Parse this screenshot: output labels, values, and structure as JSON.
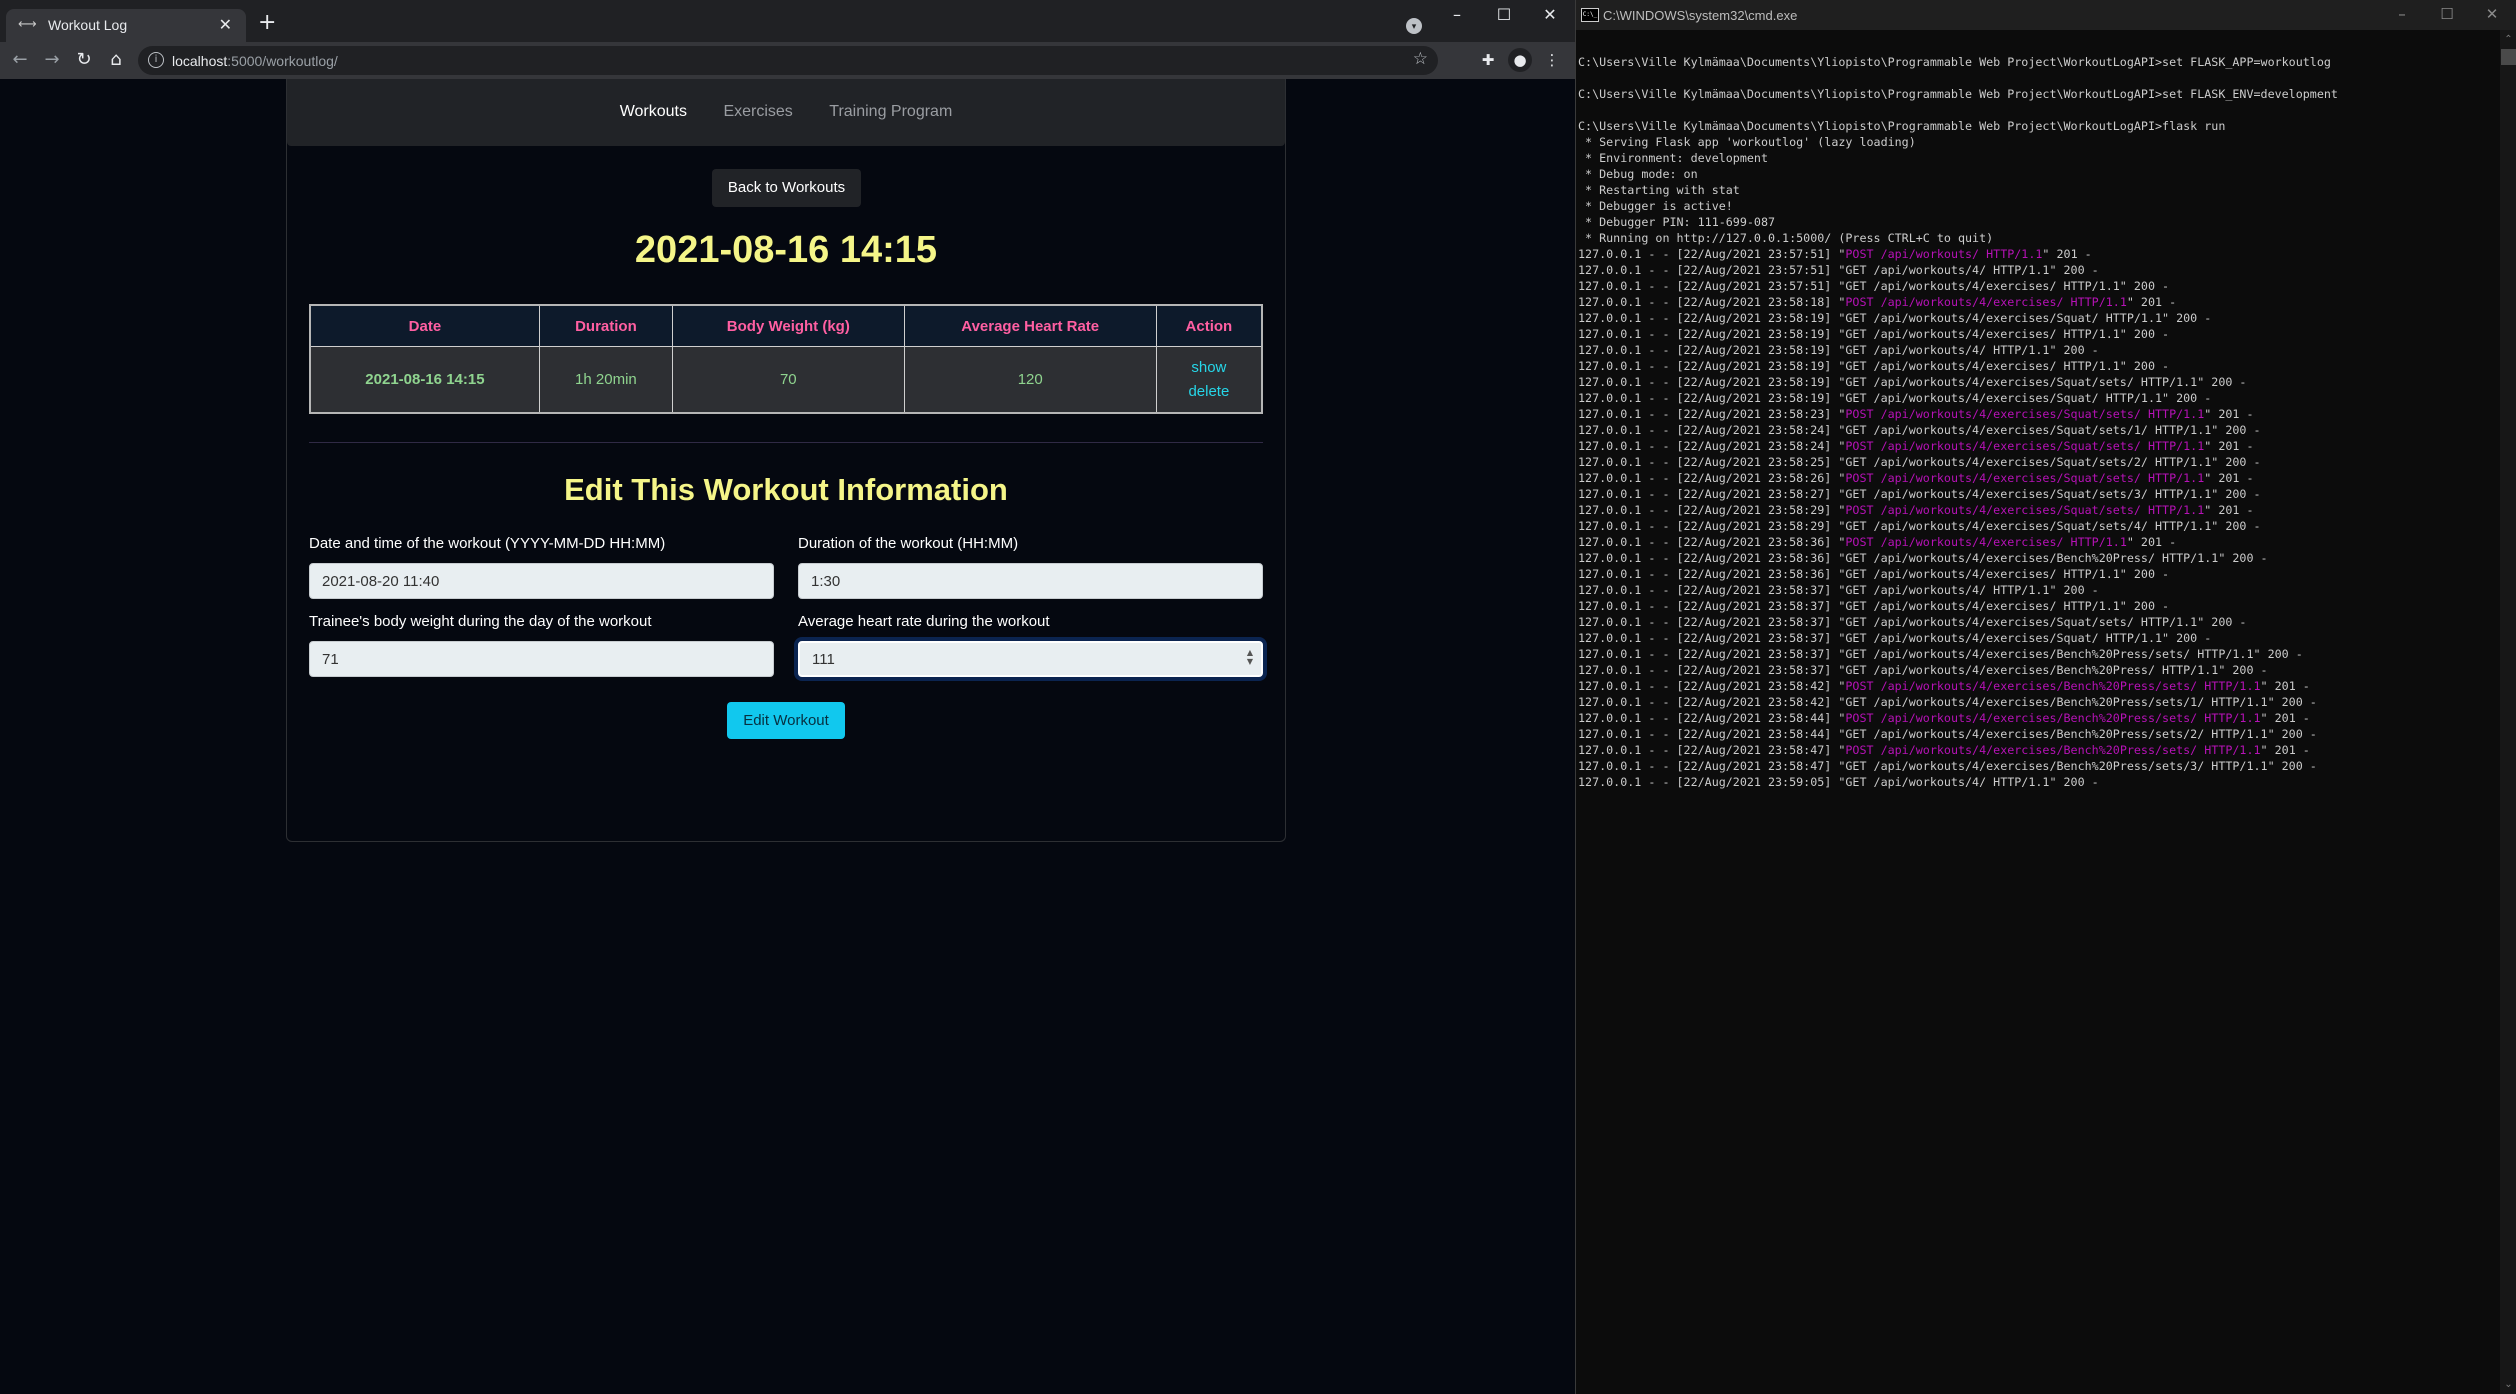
{
  "browser": {
    "tab_title": "Workout Log",
    "url_host": "localhost",
    "url_rest": ":5000/workoutlog/",
    "icons": {
      "favicon": "arrows-horizontal-icon",
      "close": "close-icon",
      "new_tab": "plus-icon",
      "back": "arrow-left-icon",
      "forward": "arrow-right-icon",
      "reload": "reload-icon",
      "home": "home-icon",
      "site_info": "info-icon",
      "bookmark": "star-icon",
      "extensions": "puzzle-icon",
      "profile": "person-icon",
      "menu": "kebab-icon"
    }
  },
  "nav": {
    "items": [
      {
        "label": "Workouts",
        "active": true
      },
      {
        "label": "Exercises",
        "active": false
      },
      {
        "label": "Training Program",
        "active": false
      }
    ]
  },
  "page": {
    "back_button": "Back to Workouts",
    "workout_title": "2021-08-16 14:15",
    "table": {
      "headers": [
        "Date",
        "Duration",
        "Body Weight (kg)",
        "Average Heart Rate",
        "Action"
      ],
      "rows": [
        {
          "date": "2021-08-16 14:15",
          "duration": "1h 20min",
          "body_weight": "70",
          "avg_heart_rate": "120",
          "actions": [
            "show",
            "delete"
          ]
        }
      ]
    },
    "edit_title": "Edit This Workout Information",
    "form": {
      "date_label": "Date and time of the workout (YYYY-MM-DD HH:MM)",
      "date_value": "2021-08-20 11:40",
      "duration_label": "Duration of the workout (HH:MM)",
      "duration_value": "1:30",
      "weight_label": "Trainee's body weight during the day of the workout",
      "weight_value": "71",
      "heart_label": "Average heart rate during the workout",
      "heart_value": "111",
      "submit": "Edit Workout"
    },
    "colors": {
      "title": "#f5f588",
      "table_header": "#ff5fa2",
      "table_cell": "#8fd48f",
      "link": "#26d6e8",
      "submit": "#11c8ee"
    }
  },
  "cmd": {
    "title": "C:\\WINDOWS\\system32\\cmd.exe",
    "lines": [
      {
        "text": ""
      },
      {
        "text": "C:\\Users\\Ville Kylmämaa\\Documents\\Yliopisto\\Programmable Web Project\\WorkoutLogAPI>set FLASK_APP=workoutlog"
      },
      {
        "text": ""
      },
      {
        "text": "C:\\Users\\Ville Kylmämaa\\Documents\\Yliopisto\\Programmable Web Project\\WorkoutLogAPI>set FLASK_ENV=development"
      },
      {
        "text": ""
      },
      {
        "text": "C:\\Users\\Ville Kylmämaa\\Documents\\Yliopisto\\Programmable Web Project\\WorkoutLogAPI>flask run"
      },
      {
        "text": " * Serving Flask app 'workoutlog' (lazy loading)"
      },
      {
        "text": " * Environment: development"
      },
      {
        "text": " * Debug mode: on"
      },
      {
        "text": " * Restarting with stat"
      },
      {
        "text": " * Debugger is active!"
      },
      {
        "text": " * Debugger PIN: 111-699-087"
      },
      {
        "text": " * Running on http://127.0.0.1:5000/ (Press CTRL+C to quit)"
      },
      {
        "pre": "127.0.0.1 - - [22/Aug/2021 23:57:51] \"",
        "req": "POST /api/workouts/ HTTP/1.1",
        "post": "\" 201 -"
      },
      {
        "pre": "127.0.0.1 - - [22/Aug/2021 23:57:51] \"GET /api/workouts/4/ HTTP/1.1\" 200 -"
      },
      {
        "pre": "127.0.0.1 - - [22/Aug/2021 23:57:51] \"GET /api/workouts/4/exercises/ HTTP/1.1\" 200 -"
      },
      {
        "pre": "127.0.0.1 - - [22/Aug/2021 23:58:18] \"",
        "req": "POST /api/workouts/4/exercises/ HTTP/1.1",
        "post": "\" 201 -"
      },
      {
        "pre": "127.0.0.1 - - [22/Aug/2021 23:58:19] \"GET /api/workouts/4/exercises/Squat/ HTTP/1.1\" 200 -"
      },
      {
        "pre": "127.0.0.1 - - [22/Aug/2021 23:58:19] \"GET /api/workouts/4/exercises/ HTTP/1.1\" 200 -"
      },
      {
        "pre": "127.0.0.1 - - [22/Aug/2021 23:58:19] \"GET /api/workouts/4/ HTTP/1.1\" 200 -"
      },
      {
        "pre": "127.0.0.1 - - [22/Aug/2021 23:58:19] \"GET /api/workouts/4/exercises/ HTTP/1.1\" 200 -"
      },
      {
        "pre": "127.0.0.1 - - [22/Aug/2021 23:58:19] \"GET /api/workouts/4/exercises/Squat/sets/ HTTP/1.1\" 200 -"
      },
      {
        "pre": "127.0.0.1 - - [22/Aug/2021 23:58:19] \"GET /api/workouts/4/exercises/Squat/ HTTP/1.1\" 200 -"
      },
      {
        "pre": "127.0.0.1 - - [22/Aug/2021 23:58:23] \"",
        "req": "POST /api/workouts/4/exercises/Squat/sets/ HTTP/1.1",
        "post": "\" 201 -"
      },
      {
        "pre": "127.0.0.1 - - [22/Aug/2021 23:58:24] \"GET /api/workouts/4/exercises/Squat/sets/1/ HTTP/1.1\" 200 -"
      },
      {
        "pre": "127.0.0.1 - - [22/Aug/2021 23:58:24] \"",
        "req": "POST /api/workouts/4/exercises/Squat/sets/ HTTP/1.1",
        "post": "\" 201 -"
      },
      {
        "pre": "127.0.0.1 - - [22/Aug/2021 23:58:25] \"GET /api/workouts/4/exercises/Squat/sets/2/ HTTP/1.1\" 200 -"
      },
      {
        "pre": "127.0.0.1 - - [22/Aug/2021 23:58:26] \"",
        "req": "POST /api/workouts/4/exercises/Squat/sets/ HTTP/1.1",
        "post": "\" 201 -"
      },
      {
        "pre": "127.0.0.1 - - [22/Aug/2021 23:58:27] \"GET /api/workouts/4/exercises/Squat/sets/3/ HTTP/1.1\" 200 -"
      },
      {
        "pre": "127.0.0.1 - - [22/Aug/2021 23:58:29] \"",
        "req": "POST /api/workouts/4/exercises/Squat/sets/ HTTP/1.1",
        "post": "\" 201 -"
      },
      {
        "pre": "127.0.0.1 - - [22/Aug/2021 23:58:29] \"GET /api/workouts/4/exercises/Squat/sets/4/ HTTP/1.1\" 200 -"
      },
      {
        "pre": "127.0.0.1 - - [22/Aug/2021 23:58:36] \"",
        "req": "POST /api/workouts/4/exercises/ HTTP/1.1",
        "post": "\" 201 -"
      },
      {
        "pre": "127.0.0.1 - - [22/Aug/2021 23:58:36] \"GET /api/workouts/4/exercises/Bench%20Press/ HTTP/1.1\" 200 -"
      },
      {
        "pre": "127.0.0.1 - - [22/Aug/2021 23:58:36] \"GET /api/workouts/4/exercises/ HTTP/1.1\" 200 -"
      },
      {
        "pre": "127.0.0.1 - - [22/Aug/2021 23:58:37] \"GET /api/workouts/4/ HTTP/1.1\" 200 -"
      },
      {
        "pre": "127.0.0.1 - - [22/Aug/2021 23:58:37] \"GET /api/workouts/4/exercises/ HTTP/1.1\" 200 -"
      },
      {
        "pre": "127.0.0.1 - - [22/Aug/2021 23:58:37] \"GET /api/workouts/4/exercises/Squat/sets/ HTTP/1.1\" 200 -"
      },
      {
        "pre": "127.0.0.1 - - [22/Aug/2021 23:58:37] \"GET /api/workouts/4/exercises/Squat/ HTTP/1.1\" 200 -"
      },
      {
        "pre": "127.0.0.1 - - [22/Aug/2021 23:58:37] \"GET /api/workouts/4/exercises/Bench%20Press/sets/ HTTP/1.1\" 200 -"
      },
      {
        "pre": "127.0.0.1 - - [22/Aug/2021 23:58:37] \"GET /api/workouts/4/exercises/Bench%20Press/ HTTP/1.1\" 200 -"
      },
      {
        "pre": "127.0.0.1 - - [22/Aug/2021 23:58:42] \"",
        "req": "POST /api/workouts/4/exercises/Bench%20Press/sets/ HTTP/1.1",
        "post": "\" 201 -"
      },
      {
        "pre": "127.0.0.1 - - [22/Aug/2021 23:58:42] \"GET /api/workouts/4/exercises/Bench%20Press/sets/1/ HTTP/1.1\" 200 -"
      },
      {
        "pre": "127.0.0.1 - - [22/Aug/2021 23:58:44] \"",
        "req": "POST /api/workouts/4/exercises/Bench%20Press/sets/ HTTP/1.1",
        "post": "\" 201 -"
      },
      {
        "pre": "127.0.0.1 - - [22/Aug/2021 23:58:44] \"GET /api/workouts/4/exercises/Bench%20Press/sets/2/ HTTP/1.1\" 200 -"
      },
      {
        "pre": "127.0.0.1 - - [22/Aug/2021 23:58:47] \"",
        "req": "POST /api/workouts/4/exercises/Bench%20Press/sets/ HTTP/1.1",
        "post": "\" 201 -"
      },
      {
        "pre": "127.0.0.1 - - [22/Aug/2021 23:58:47] \"GET /api/workouts/4/exercises/Bench%20Press/sets/3/ HTTP/1.1\" 200 -"
      },
      {
        "pre": "127.0.0.1 - - [22/Aug/2021 23:59:05] \"GET /api/workouts/4/ HTTP/1.1\" 200 -"
      }
    ],
    "colors": {
      "text": "#cccccc",
      "request_highlight": "#b612b6",
      "background": "#0c0c0c"
    }
  }
}
